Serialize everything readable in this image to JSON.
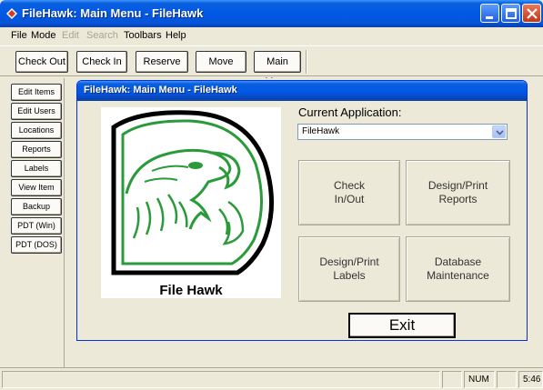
{
  "window": {
    "title": "FileHawk:  Main Menu - FileHawk"
  },
  "menubar": {
    "items": [
      {
        "label": "File",
        "enabled": true
      },
      {
        "label": "Mode",
        "enabled": true
      },
      {
        "label": "Edit",
        "enabled": false
      },
      {
        "label": "Search",
        "enabled": false
      },
      {
        "label": "Toolbars",
        "enabled": true
      },
      {
        "label": "Help",
        "enabled": true
      }
    ]
  },
  "toolbar": {
    "buttons": [
      "Check Out",
      "Check In",
      "Reserve",
      "Move",
      "Main Menu"
    ]
  },
  "sidebar": {
    "buttons": [
      "Edit Items",
      "Edit Users",
      "Locations",
      "Reports",
      "Labels",
      "View Item",
      "Backup",
      "PDT (Win)",
      "PDT (DOS)"
    ]
  },
  "inner_window": {
    "title": "FileHawk:  Main Menu - FileHawk",
    "logo_caption": "File Hawk",
    "current_app_label": "Current Application:",
    "current_app_value": "FileHawk",
    "buttons": {
      "check_in_out": "Check\nIn/Out",
      "design_print_reports": "Design/Print\nReports",
      "design_print_labels": "Design/Print\nLabels",
      "database_maintenance": "Database\nMaintenance",
      "exit": "Exit"
    }
  },
  "statusbar": {
    "panes": [
      "",
      "",
      "NUM",
      "",
      "5:46"
    ]
  },
  "colors": {
    "titlebar_blue": "#0058e6",
    "logo_green": "#2a9a3a",
    "window_bg": "#ece9d8"
  }
}
